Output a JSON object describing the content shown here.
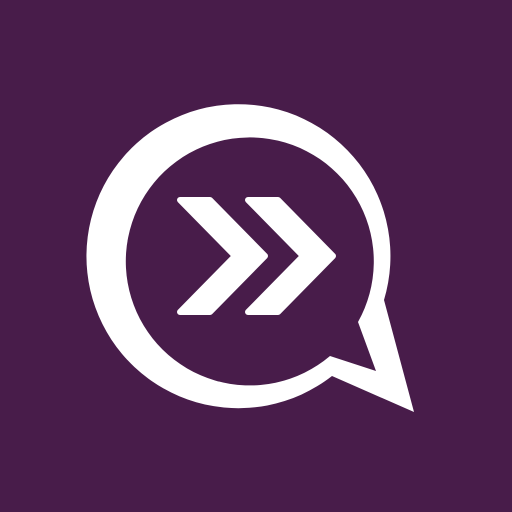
{
  "icon": {
    "name": "chat-bubble-fast-forward-icon",
    "background_color": "#481c4a",
    "foreground_color": "#ffffff"
  }
}
